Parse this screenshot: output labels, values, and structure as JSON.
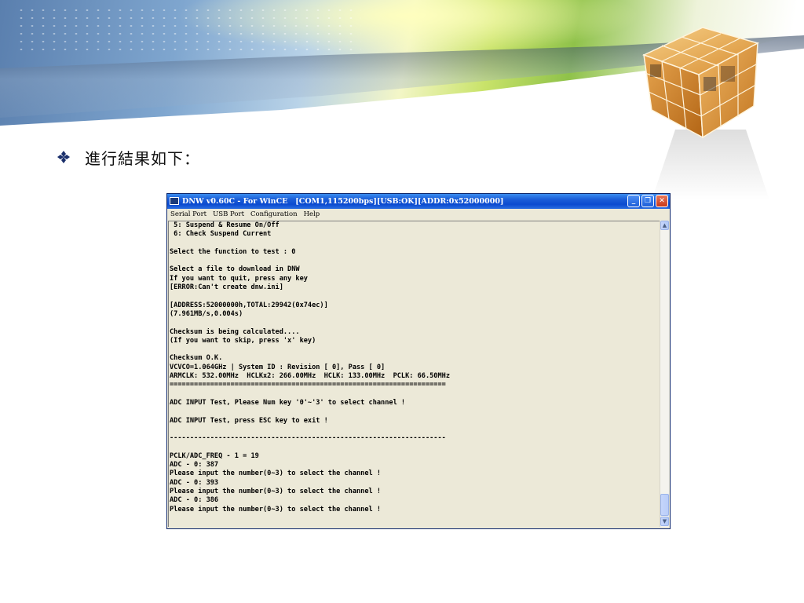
{
  "slide": {
    "bullet_text": "進行結果如下："
  },
  "window": {
    "title": "DNW v0.60C - For WinCE   [COM1,115200bps][USB:OK][ADDR:0x52000000]",
    "controls": {
      "minimize": "_",
      "restore": "❐",
      "close": "✕"
    },
    "menu": [
      "Serial Port",
      "USB Port",
      "Configuration",
      "Help"
    ]
  },
  "console": {
    "lines": [
      " 5: Suspend & Resume On/Off",
      " 6: Check Suspend Current",
      "",
      "Select the function to test : 0",
      "",
      "Select a file to download in DNW",
      "If you want to quit, press any key",
      "[ERROR:Can't create dnw.ini]",
      "",
      "[ADDRESS:52000000h,TOTAL:29942(0x74ec)]",
      "(7.961MB/s,0.004s)",
      "",
      "Checksum is being calculated....",
      "(If you want to skip, press 'x' key)",
      "",
      "Checksum O.K.",
      "VCVCO=1.064GHz | System ID : Revision [ 0], Pass [ 0]",
      "ARMCLK: 532.00MHz  HCLKx2: 266.00MHz  HCLK: 133.00MHz  PCLK: 66.50MHz",
      "====================================================================",
      "",
      "ADC INPUT Test, Please Num key '0'~'3' to select channel !",
      "",
      "ADC INPUT Test, press ESC key to exit !",
      "",
      "--------------------------------------------------------------------",
      "",
      "PCLK/ADC_FREQ - 1 = 19",
      "ADC - 0: 387",
      "Please input the number(0~3) to select the channel !",
      "ADC - 0: 393",
      "Please input the number(0~3) to select the channel !",
      "ADC - 0: 386",
      "Please input the number(0~3) to select the channel !"
    ]
  },
  "icons": {
    "bullet": "diamond-bullet-icon",
    "logo": "cube-logo-icon",
    "app": "dnw-app-icon"
  },
  "colors": {
    "titlebar": "#0b4ad0",
    "console_bg": "#ece9d8",
    "close_button": "#c8391a"
  }
}
